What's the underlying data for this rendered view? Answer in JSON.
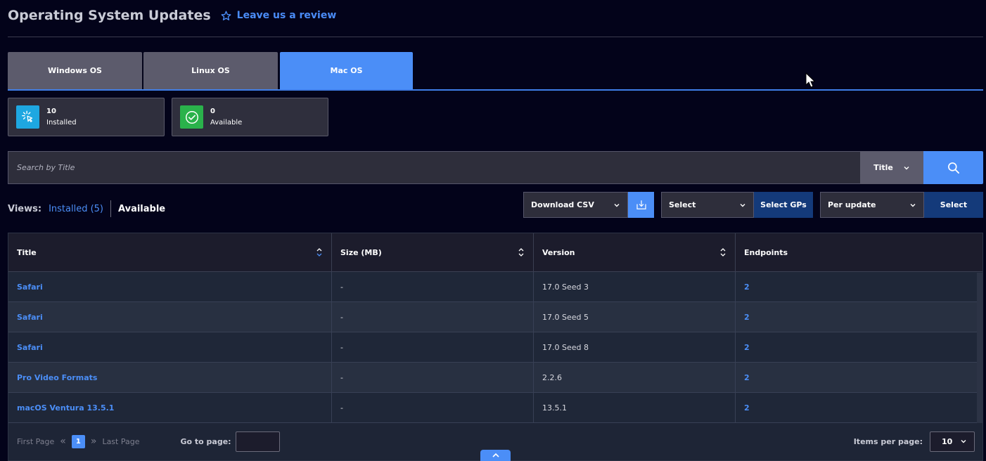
{
  "header": {
    "title": "Operating System Updates",
    "review_label": "Leave us a review"
  },
  "tabs": [
    {
      "label": "Windows OS",
      "active": false
    },
    {
      "label": "Linux OS",
      "active": false
    },
    {
      "label": "Mac OS",
      "active": true
    }
  ],
  "stats": {
    "installed": {
      "count": "10",
      "label": "Installed",
      "color": "#1ea7e1"
    },
    "available": {
      "count": "0",
      "label": "Available",
      "color": "#2ab24b"
    }
  },
  "search": {
    "placeholder": "Search by Title",
    "field": "Title"
  },
  "views": {
    "label": "Views:",
    "installed": "Installed (5)",
    "available": "Available"
  },
  "toolbar": {
    "download_label": "Download CSV",
    "group_select": "Select",
    "select_gps_label": "Select GPs",
    "per_update_select": "Per update",
    "select_label": "Select"
  },
  "table": {
    "columns": [
      "Title",
      "Size (MB)",
      "Version",
      "Endpoints"
    ],
    "rows": [
      {
        "title": "Safari",
        "size": "-",
        "version": "17.0 Seed 3",
        "endpoints": "2"
      },
      {
        "title": "Safari",
        "size": "-",
        "version": "17.0 Seed 5",
        "endpoints": "2"
      },
      {
        "title": "Safari",
        "size": "-",
        "version": "17.0 Seed 8",
        "endpoints": "2"
      },
      {
        "title": "Pro Video Formats",
        "size": "-",
        "version": "2.2.6",
        "endpoints": "2"
      },
      {
        "title": "macOS Ventura 13.5.1",
        "size": "-",
        "version": "13.5.1",
        "endpoints": "2"
      }
    ]
  },
  "pagination": {
    "first_label": "First Page",
    "last_label": "Last Page",
    "current_page": "1",
    "goto_label": "Go to page:",
    "goto_value": "",
    "items_per_page_label": "Items per page:",
    "items_per_page": "10"
  },
  "colors": {
    "background": "#03031a",
    "accent": "#4b8ef7",
    "dark_button": "#143a7a"
  }
}
